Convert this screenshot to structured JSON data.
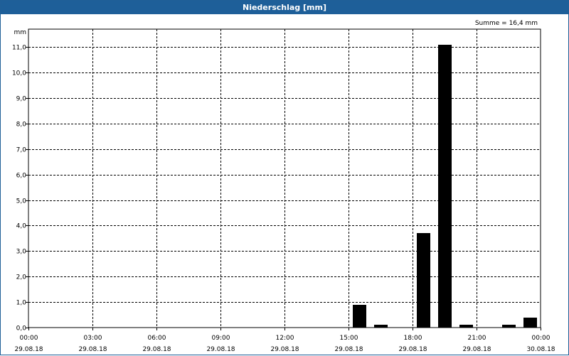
{
  "window": {
    "title": "Niederschlag [mm]"
  },
  "chart_data": {
    "type": "bar",
    "title": "Niederschlag [mm]",
    "ylabel": "mm",
    "annotation": "Summe = 16,4 mm",
    "ylim": [
      0,
      11.7
    ],
    "y_ticks": [
      {
        "value": 0,
        "label": "0,0"
      },
      {
        "value": 1,
        "label": "1,0"
      },
      {
        "value": 2,
        "label": "2,0"
      },
      {
        "value": 3,
        "label": "3,0"
      },
      {
        "value": 4,
        "label": "4,0"
      },
      {
        "value": 5,
        "label": "5,0"
      },
      {
        "value": 6,
        "label": "6,0"
      },
      {
        "value": 7,
        "label": "7,0"
      },
      {
        "value": 8,
        "label": "8,0"
      },
      {
        "value": 9,
        "label": "9,0"
      },
      {
        "value": 10,
        "label": "10,0"
      },
      {
        "value": 11,
        "label": "11,0"
      }
    ],
    "x_ticks": [
      {
        "time": "00:00",
        "date": "29.08.18"
      },
      {
        "time": "03:00",
        "date": "29.08.18"
      },
      {
        "time": "06:00",
        "date": "29.08.18"
      },
      {
        "time": "09:00",
        "date": "29.08.18"
      },
      {
        "time": "12:00",
        "date": "29.08.18"
      },
      {
        "time": "15:00",
        "date": "29.08.18"
      },
      {
        "time": "18:00",
        "date": "29.08.18"
      },
      {
        "time": "21:00",
        "date": "29.08.18"
      },
      {
        "time": "00:00",
        "date": "30.08.18"
      }
    ],
    "x_interval": "1 hour",
    "series": [
      {
        "x": [
          "29.08.18 15:00",
          "29.08.18 16:00",
          "29.08.18 18:00",
          "29.08.18 19:00",
          "29.08.18 20:00",
          "29.08.18 22:00",
          "29.08.18 23:00"
        ],
        "values": [
          0.9,
          0.1,
          3.7,
          11.1,
          0.1,
          0.1,
          0.4
        ]
      }
    ],
    "bar_color": "#000000",
    "grid": true,
    "grid_style": "dashed"
  }
}
